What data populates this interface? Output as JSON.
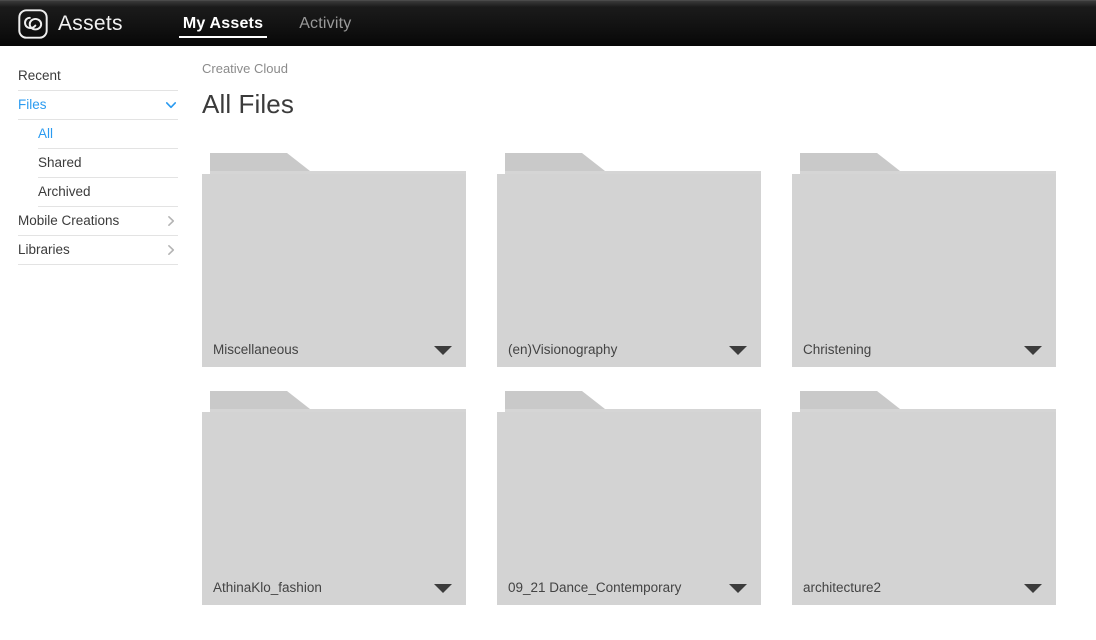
{
  "header": {
    "logo_icon": "creative-cloud-logo",
    "brand": "Assets",
    "tabs": [
      {
        "label": "My Assets",
        "active": true
      },
      {
        "label": "Activity",
        "active": false
      }
    ]
  },
  "sidebar": {
    "items": [
      {
        "label": "Recent",
        "accent": false,
        "sub": false,
        "icon": ""
      },
      {
        "label": "Files",
        "accent": true,
        "sub": false,
        "icon": "chevron-down-icon"
      },
      {
        "label": "All",
        "accent": true,
        "sub": true,
        "icon": ""
      },
      {
        "label": "Shared",
        "accent": false,
        "sub": true,
        "icon": ""
      },
      {
        "label": "Archived",
        "accent": false,
        "sub": true,
        "icon": ""
      },
      {
        "label": "Mobile Creations",
        "accent": false,
        "sub": false,
        "icon": "chevron-right-icon"
      },
      {
        "label": "Libraries",
        "accent": false,
        "sub": false,
        "icon": "chevron-right-icon"
      }
    ]
  },
  "main": {
    "breadcrumb": "Creative Cloud",
    "title": "All Files",
    "folders": [
      {
        "name": "Miscellaneous"
      },
      {
        "name": "(en)Visionography"
      },
      {
        "name": "Christening"
      },
      {
        "name": "AthinaKlo_fashion"
      },
      {
        "name": "09_21 Dance_Contemporary"
      },
      {
        "name": "architecture2"
      }
    ],
    "folder_menu_icon": "caret-down-icon"
  },
  "colors": {
    "accent_blue": "#2b9bf0",
    "header_dark": "#121212",
    "folder_tab": "#c9c9c9",
    "folder_body": "#d3d3d3",
    "text_dark": "#3b3b3b",
    "text_muted": "#8b8b8b"
  }
}
